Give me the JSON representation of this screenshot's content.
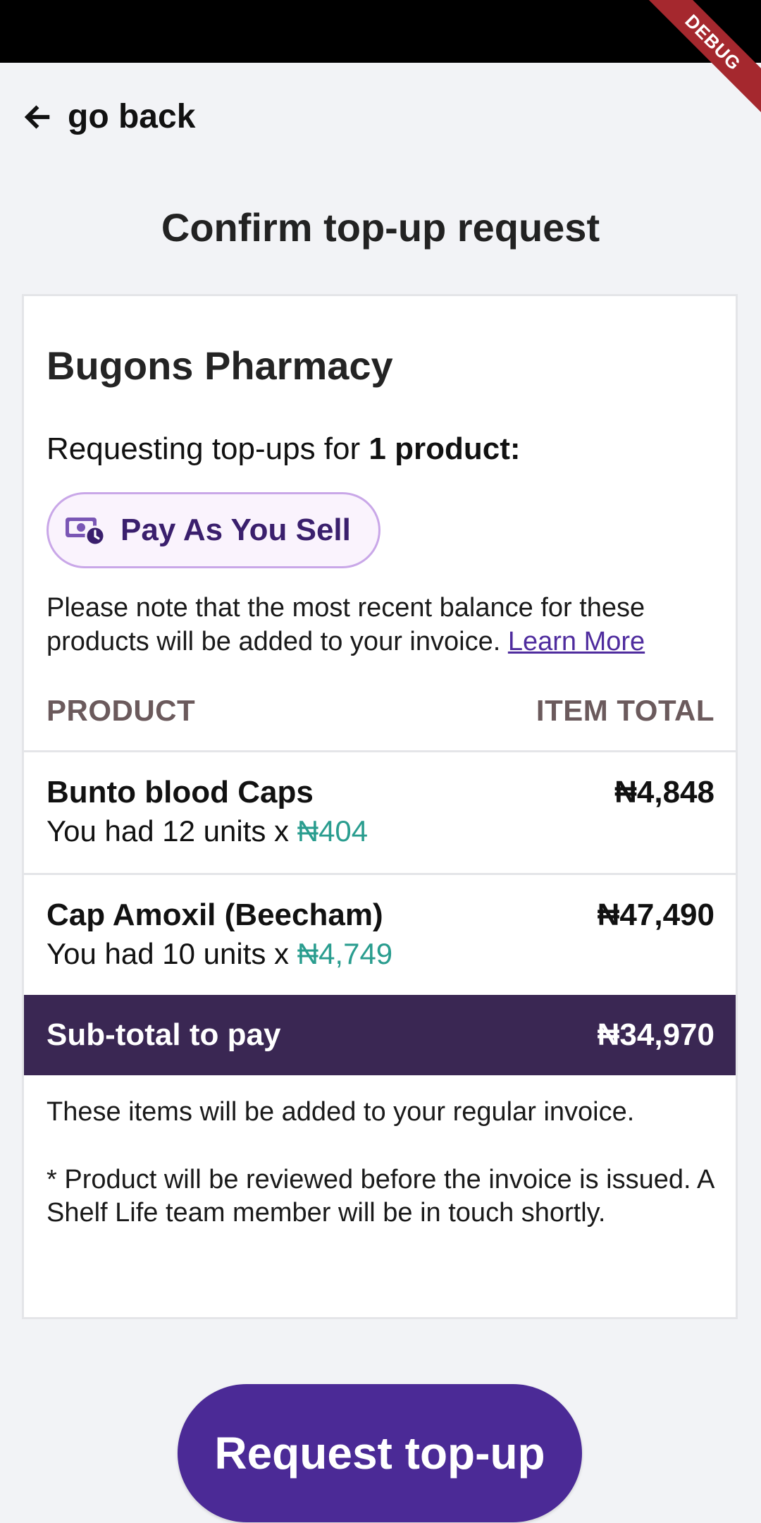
{
  "debug_banner": "DEBUG",
  "nav": {
    "back_label": "go back"
  },
  "page": {
    "title": "Confirm top-up request"
  },
  "card": {
    "pharmacy_name": "Bugons Pharmacy",
    "requesting_prefix": "Requesting top-ups for ",
    "requesting_count": "1 product:",
    "plan_label": "Pay As You Sell",
    "note_text": "Please note that the most recent balance for these products will be added to your invoice. ",
    "learn_more": "Learn More",
    "columns": {
      "product": "PRODUCT",
      "total": "ITEM TOTAL"
    },
    "items": [
      {
        "name": "Bunto blood Caps",
        "sub_prefix": "You had 12 units x ",
        "unit_price": "₦404",
        "total": "₦4,848"
      },
      {
        "name": "Cap Amoxil (Beecham)",
        "sub_prefix": "You had 10 units x ",
        "unit_price": "₦4,749",
        "total": "₦47,490"
      }
    ],
    "subtotal_label": "Sub-total to pay",
    "subtotal_value": "₦34,970",
    "info_regular": "These items will be added to your regular invoice.",
    "info_review": "* Product will be reviewed before the invoice is issued. A Shelf Life team member will be in touch shortly."
  },
  "cta": {
    "label": "Request top-up"
  },
  "colors": {
    "primary": "#4b2a96",
    "subtotal_bg": "#3a2753",
    "price_teal": "#2a9d8f",
    "pill_border": "#c9a7e8"
  }
}
